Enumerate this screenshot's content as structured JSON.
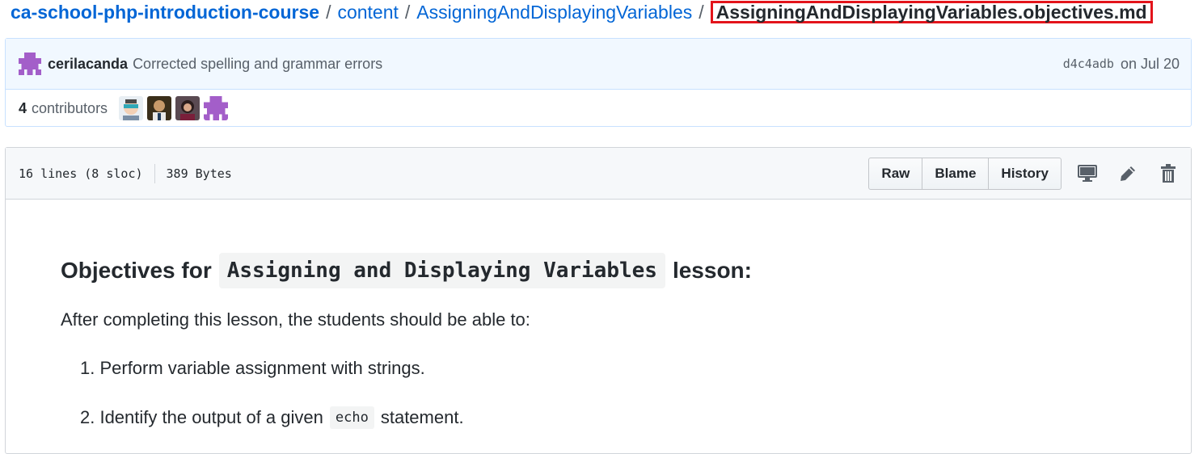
{
  "breadcrumb": {
    "repo": "ca-school-php-introduction-course",
    "separator": "/",
    "path": [
      "content",
      "AssigningAndDisplayingVariables"
    ],
    "file": "AssigningAndDisplayingVariables.objectives.md"
  },
  "commit": {
    "author": "cerilacanda",
    "message": "Corrected spelling and grammar errors",
    "sha": "d4c4adb",
    "date": "on Jul 20"
  },
  "contributors": {
    "count": "4",
    "label": "contributors"
  },
  "file_header": {
    "lines": "16 lines (8 sloc)",
    "size": "389 Bytes",
    "buttons": [
      "Raw",
      "Blame",
      "History"
    ]
  },
  "markdown": {
    "heading_prefix": "Objectives for",
    "heading_code": "Assigning and Displaying Variables",
    "heading_suffix": "lesson:",
    "paragraph": "After completing this lesson, the students should be able to:",
    "item1": "1. Perform variable assignment with strings.",
    "item2_prefix": "2. Identify the output of a given",
    "item2_code": "echo",
    "item2_suffix": "statement."
  },
  "icons": {
    "desktop": "desktop-icon",
    "edit": "pencil-icon",
    "delete": "trash-icon"
  },
  "colors": {
    "link": "#0366d6",
    "highlight_border": "#e3141b",
    "commit_bg": "#f1f8ff",
    "avatar_purple": "#a35ec9"
  }
}
